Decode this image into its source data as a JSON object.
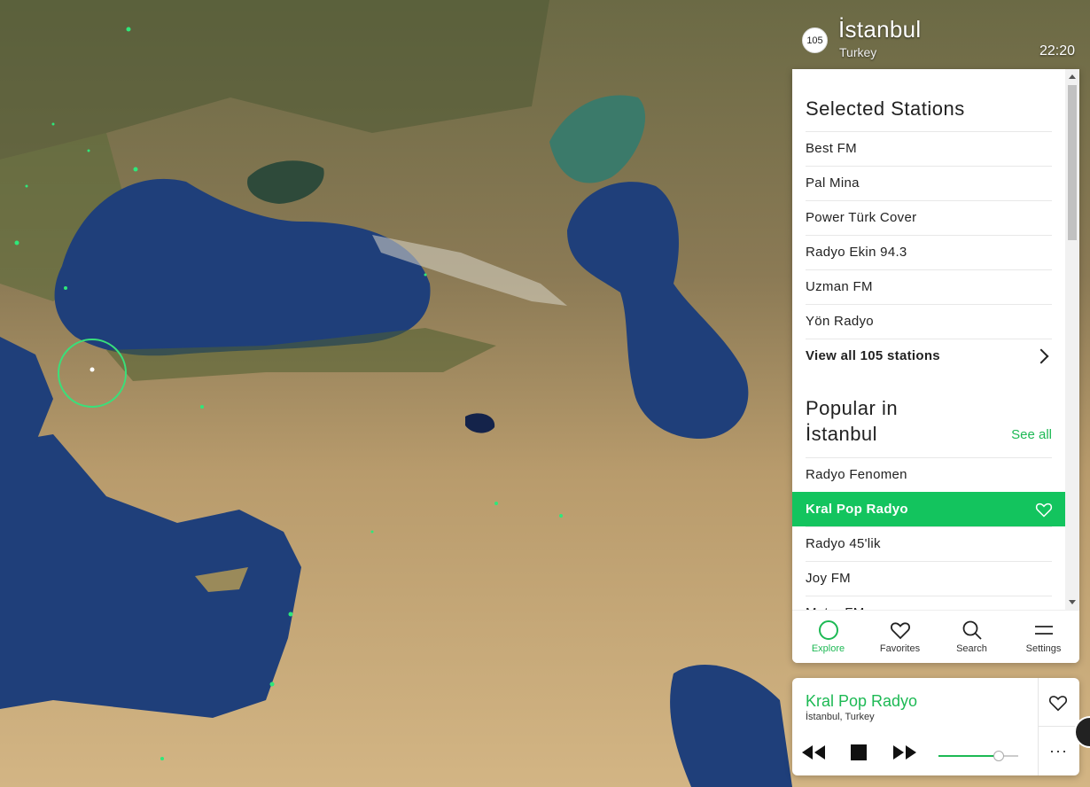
{
  "city": {
    "station_count": "105",
    "name": "İstanbul",
    "country": "Turkey",
    "local_time": "22:20"
  },
  "selected": {
    "title": "Selected Stations",
    "stations": [
      "Best FM",
      "Pal Mina",
      "Power Türk Cover",
      "Radyo Ekin 94.3",
      "Uzman FM",
      "Yön Radyo"
    ],
    "view_all_label": "View all 105 stations"
  },
  "popular": {
    "title_line1": "Popular in",
    "title_line2": "İstanbul",
    "see_all_label": "See all",
    "stations": [
      "Radyo Fenomen",
      "Kral Pop Radyo",
      "Radyo 45'lik",
      "Joy FM",
      "Metro FM"
    ],
    "active_station": "Kral Pop Radyo"
  },
  "nav": {
    "explore": "Explore",
    "favorites": "Favorites",
    "search": "Search",
    "settings": "Settings"
  },
  "player": {
    "station": "Kral Pop Radyo",
    "location": "İstanbul, Turkey",
    "volume": 0.75,
    "more_label": "···"
  },
  "colors": {
    "accent": "#1db954",
    "active_row": "#13c45e",
    "sea": "#1f3f7a",
    "land": "#c9ac7f"
  }
}
